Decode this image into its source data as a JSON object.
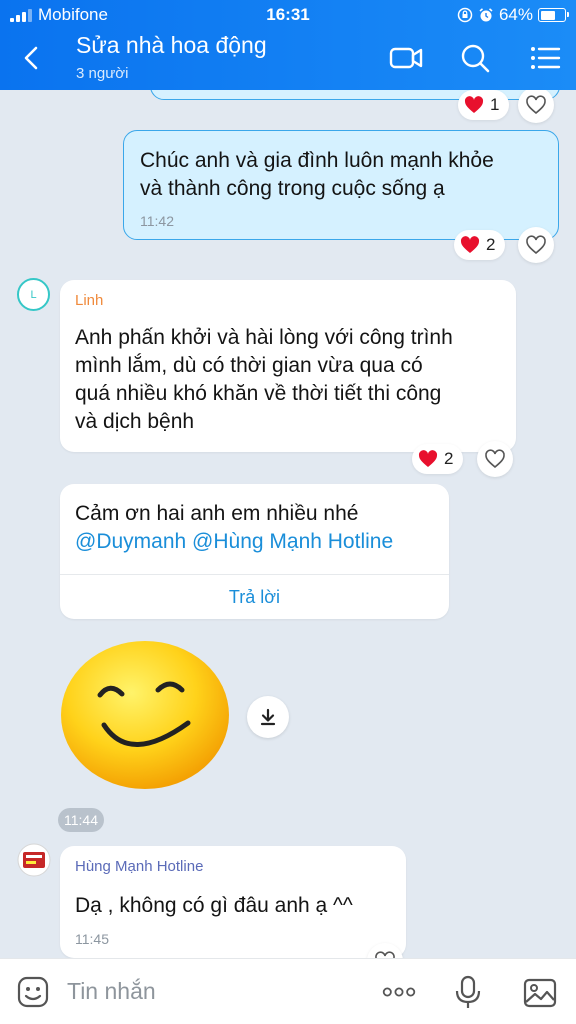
{
  "status_bar": {
    "carrier": "Mobifone",
    "time": "16:31",
    "battery": "64%",
    "battery_level": 0.64
  },
  "header": {
    "title": "Sửa nhà hoa động",
    "subtitle": "3 người"
  },
  "messages": [
    {
      "from": "me",
      "text_lines": [
        "Chúc anh và gia đình luôn mạnh khỏe",
        "và thành công trong cuộc sống ạ"
      ],
      "time": "11:42",
      "reaction_count": "2"
    },
    {
      "from": "Linh",
      "avatar_letter": "L",
      "sender_color": "#f08a3c",
      "text_lines": [
        "Anh phấn khởi và hài lòng với công trình",
        "mình lắm,  dù có thời gian vừa qua có",
        "quá nhiều khó khăn về thời tiết thi công",
        "và dịch bệnh"
      ],
      "reaction_count": "2"
    },
    {
      "from": "Linh",
      "text_line1": "Cảm ơn hai anh em nhiều nhé",
      "mentions": [
        "@Duymanh",
        "@Hùng Mạnh Hotline"
      ],
      "reply_label": "Trả lời"
    },
    {
      "from": "Linh",
      "type": "sticker",
      "sticker": "smiley-face",
      "time": "11:44"
    },
    {
      "from": "Hùng Mạnh Hotline",
      "sender_color": "#5b6bb8",
      "text": "Dạ , không có gì đâu anh ạ ^^",
      "time": "11:45"
    }
  ],
  "top_partial": {
    "reaction_count": "1"
  },
  "input": {
    "placeholder": "Tin nhắn"
  },
  "colors": {
    "header": "#0a73ef",
    "accent": "#1a8ed9",
    "my_bubble": "#d5f1ff",
    "heart": "#e8102d"
  }
}
